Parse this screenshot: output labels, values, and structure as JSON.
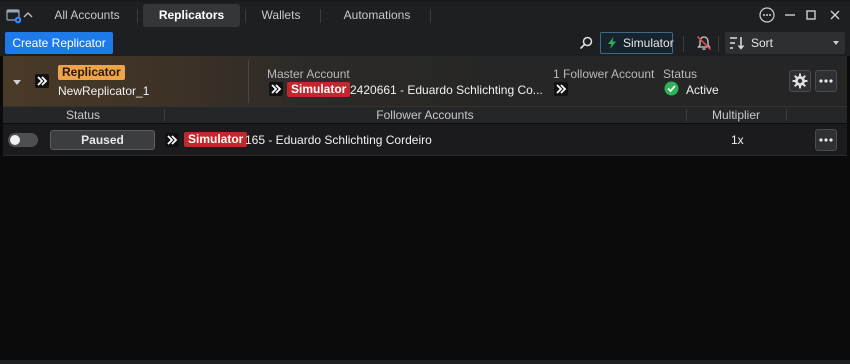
{
  "tabs": [
    "All Accounts",
    "Replicators",
    "Wallets",
    "Automations"
  ],
  "toolbar": {
    "create_label": "Create Replicator",
    "simulator_label": "Simulator",
    "sort_label": "Sort"
  },
  "replicator": {
    "badge": "Replicator",
    "name": "NewReplicator_1",
    "master_label": "Master Account",
    "master_badge": "Simulator",
    "master_account": "2420661 - Eduardo Schlichting Co...",
    "follower_count_label": "1 Follower Account",
    "status_label": "Status",
    "status_value": "Active"
  },
  "columns": {
    "status": "Status",
    "followers": "Follower Accounts",
    "multiplier": "Multiplier"
  },
  "rows": [
    {
      "state": "Paused",
      "badge": "Simulator",
      "account": "165 - Eduardo Schlichting Cordeiro",
      "multiplier": "1x"
    }
  ],
  "colors": {
    "primary": "#1d7ae8",
    "replicator_badge": "#f0a448",
    "simulator_badge": "#c1272d",
    "active": "#2fb157",
    "background": "#0b0b0b"
  },
  "icons": {
    "app": "app-window-icon",
    "search": "search-icon",
    "simulator": "lightning-icon",
    "notifications": "bell-off-icon",
    "sort": "sort-icon",
    "settings": "gear-icon",
    "more": "ellipsis-icon",
    "account": "double-chevron-icon",
    "status": "check-circle-icon"
  }
}
